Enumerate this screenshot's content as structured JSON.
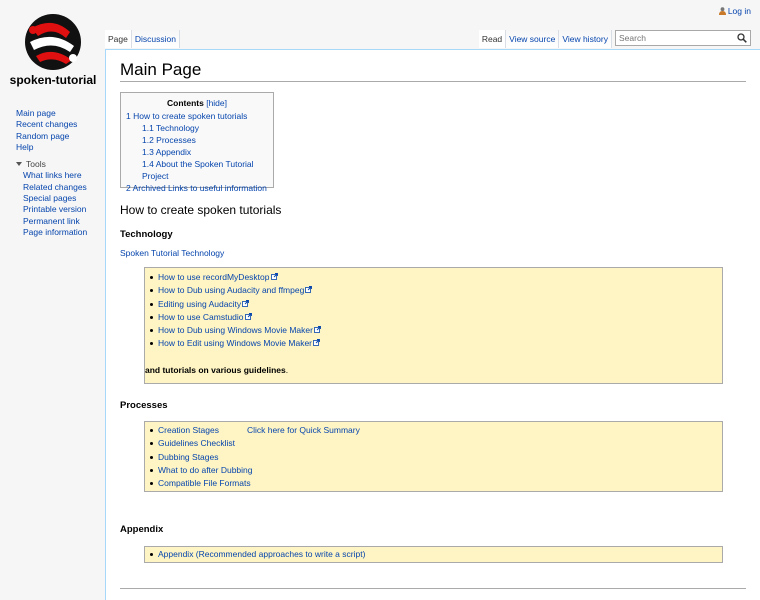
{
  "header": {
    "login_label": "Log in",
    "logo_text": "spoken-tutorial"
  },
  "sidebar": {
    "nav": [
      "Main page",
      "Recent changes",
      "Random page",
      "Help"
    ],
    "tools_heading": "Tools",
    "tools": [
      "What links here",
      "Related changes",
      "Special pages",
      "Printable version",
      "Permanent link",
      "Page information"
    ]
  },
  "tabs": {
    "left": [
      "Page",
      "Discussion"
    ],
    "right": [
      "Read",
      "View source",
      "View history"
    ]
  },
  "search": {
    "placeholder": "Search"
  },
  "page": {
    "title": "Main Page",
    "toc": {
      "title": "Contents",
      "hide_label": "[hide]",
      "items": [
        {
          "level": 1,
          "text": "1 How to create spoken tutorials"
        },
        {
          "level": 2,
          "text": "1.1 Technology"
        },
        {
          "level": 2,
          "text": "1.2 Processes"
        },
        {
          "level": 2,
          "text": "1.3 Appendix"
        },
        {
          "level": 2,
          "text": "1.4 About the Spoken Tutorial Project"
        },
        {
          "level": 1,
          "text": "2 Archived Links to useful information"
        }
      ]
    },
    "section_heading": "How to create spoken tutorials",
    "technology": {
      "heading": "Technology",
      "link": "Spoken Tutorial Technology",
      "items": [
        "How to use recordMyDesktop",
        "How to Dub using Audacity and ffmpeg",
        "Editing using Audacity",
        "How to use Camstudio",
        "How to Dub using Windows Movie Maker",
        "How to Edit using Windows Movie Maker"
      ],
      "note": "and tutorials on various guidelines",
      "note_end": "."
    },
    "processes": {
      "heading": "Processes",
      "items": [
        "Creation Stages",
        "Guidelines Checklist",
        "Dubbing Stages",
        "What to do after Dubbing",
        "Compatible File Formats"
      ],
      "quick_summary": "Click here for Quick Summary"
    },
    "appendix": {
      "heading": "Appendix",
      "items": [
        "Appendix (Recommended approaches to write a script)"
      ]
    }
  },
  "colors": {
    "link": "#0645ad",
    "box_bg": "#fff5c4",
    "border": "#a7d7f9"
  }
}
